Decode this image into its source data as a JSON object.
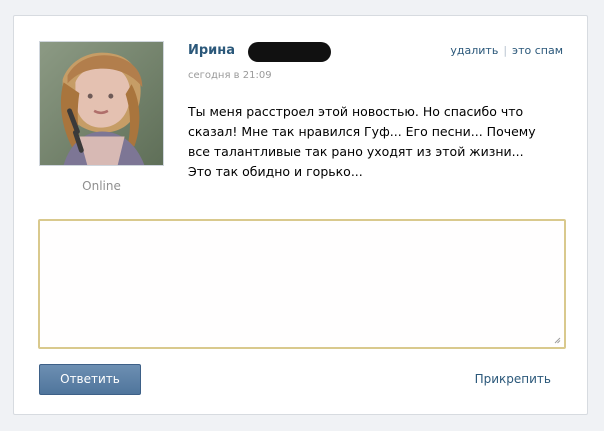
{
  "post": {
    "author": "Ирина",
    "time": "сегодня в 21:09",
    "status": "Online",
    "message": "Ты меня расстроел этой новостью. Но спасибо что сказал! Мне так нравился Гуф... Его песни... Почему все талантливые так рано уходят из этой жизни... Это так обидно и горько..."
  },
  "actions": {
    "delete": "удалить",
    "spam": "это спам"
  },
  "reply": {
    "value": "",
    "placeholder": ""
  },
  "buttons": {
    "reply": "Ответить",
    "attach": "Прикрепить"
  },
  "colors": {
    "link": "#2b587a",
    "button": "#5a7da4",
    "field_border": "#d9c98d"
  },
  "icons": {
    "resize": "resize-handle-icon"
  }
}
